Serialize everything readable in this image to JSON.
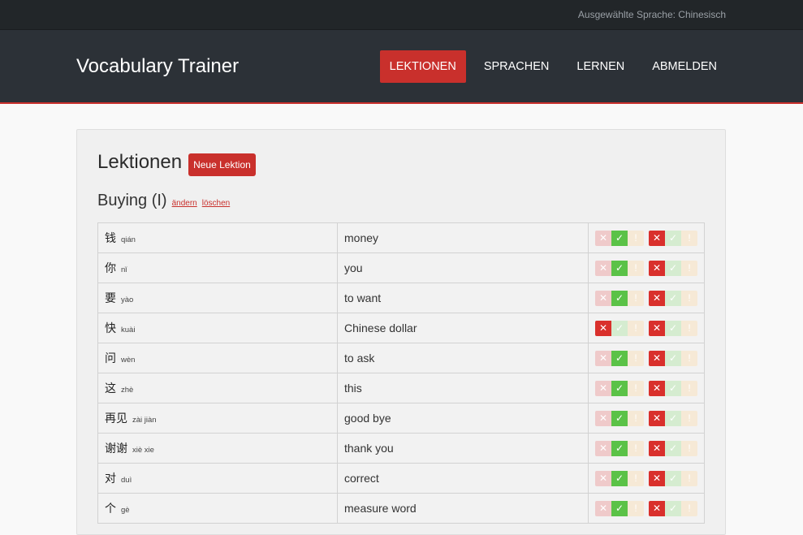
{
  "topbar": {
    "selected_language": "Ausgewählte Sprache: Chinesisch"
  },
  "brand": "Vocabulary Trainer",
  "nav": [
    {
      "label": "LEKTIONEN",
      "active": true
    },
    {
      "label": "SPRACHEN",
      "active": false
    },
    {
      "label": "LERNEN",
      "active": false
    },
    {
      "label": "ABMELDEN",
      "active": false
    }
  ],
  "page": {
    "title": "Lektionen",
    "new_button": "Neue Lektion"
  },
  "lesson": {
    "title": "Buying (I)",
    "edit_link": "ändern",
    "delete_link": "löschen"
  },
  "icons": {
    "wrong": "✕",
    "right": "✓",
    "unknown": "!"
  },
  "colors": {
    "accent": "#c9302c",
    "right": "#5bc247",
    "wrong": "#d9302c"
  },
  "rows": [
    {
      "hanzi": "钱",
      "pinyin": "qián",
      "meaning": "money",
      "status1": "right",
      "status2": "wrong"
    },
    {
      "hanzi": "你",
      "pinyin": "nǐ",
      "meaning": "you",
      "status1": "right",
      "status2": "wrong"
    },
    {
      "hanzi": "要",
      "pinyin": "yào",
      "meaning": "to want",
      "status1": "right",
      "status2": "wrong"
    },
    {
      "hanzi": "快",
      "pinyin": "kuài",
      "meaning": "Chinese dollar",
      "status1": "wrong",
      "status2": "wrong"
    },
    {
      "hanzi": "问",
      "pinyin": "wèn",
      "meaning": "to ask",
      "status1": "right",
      "status2": "wrong"
    },
    {
      "hanzi": "这",
      "pinyin": "zhè",
      "meaning": "this",
      "status1": "right",
      "status2": "wrong"
    },
    {
      "hanzi": "再见",
      "pinyin": "zài jiàn",
      "meaning": "good bye",
      "status1": "right",
      "status2": "wrong"
    },
    {
      "hanzi": "谢谢",
      "pinyin": "xiè xie",
      "meaning": "thank you",
      "status1": "right",
      "status2": "wrong"
    },
    {
      "hanzi": "对",
      "pinyin": "duì",
      "meaning": "correct",
      "status1": "right",
      "status2": "wrong"
    },
    {
      "hanzi": "个",
      "pinyin": "gè",
      "meaning": "measure word",
      "status1": "right",
      "status2": "wrong"
    }
  ]
}
